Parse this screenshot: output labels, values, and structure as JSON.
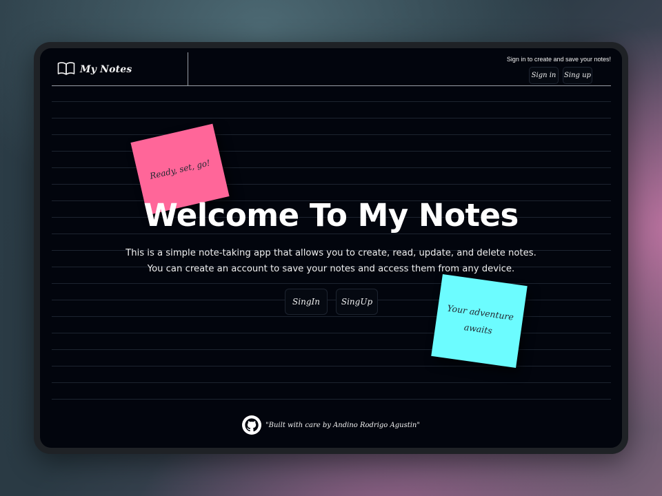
{
  "app": {
    "brand": "My Notes",
    "brand_icon": "open-book-icon"
  },
  "header": {
    "signin_hint": "Sign in to create and save your notes!",
    "signin_label": "Sign in",
    "signup_label": "Sing up"
  },
  "hero": {
    "title": "Welcome To My Notes",
    "subtitle_line1": "This is a simple note-taking app that allows you to create, read, update, and delete notes.",
    "subtitle_line2": "You can create an account to save your notes and access them from any device.",
    "signin_cta": "SingIn",
    "signup_cta": "SingUp"
  },
  "stickies": {
    "pink": "Ready, set, go!",
    "cyan_line1": "Your adventure",
    "cyan_line2": "awaits"
  },
  "footer": {
    "text": "\"Built with care by Andino Rodrigo Agustin\"",
    "icon": "github-icon"
  },
  "colors": {
    "screen_bg": "#02050d",
    "pink_note": "#ff6699",
    "cyan_note": "#6cfcff",
    "rule_line": "#1d2430"
  }
}
